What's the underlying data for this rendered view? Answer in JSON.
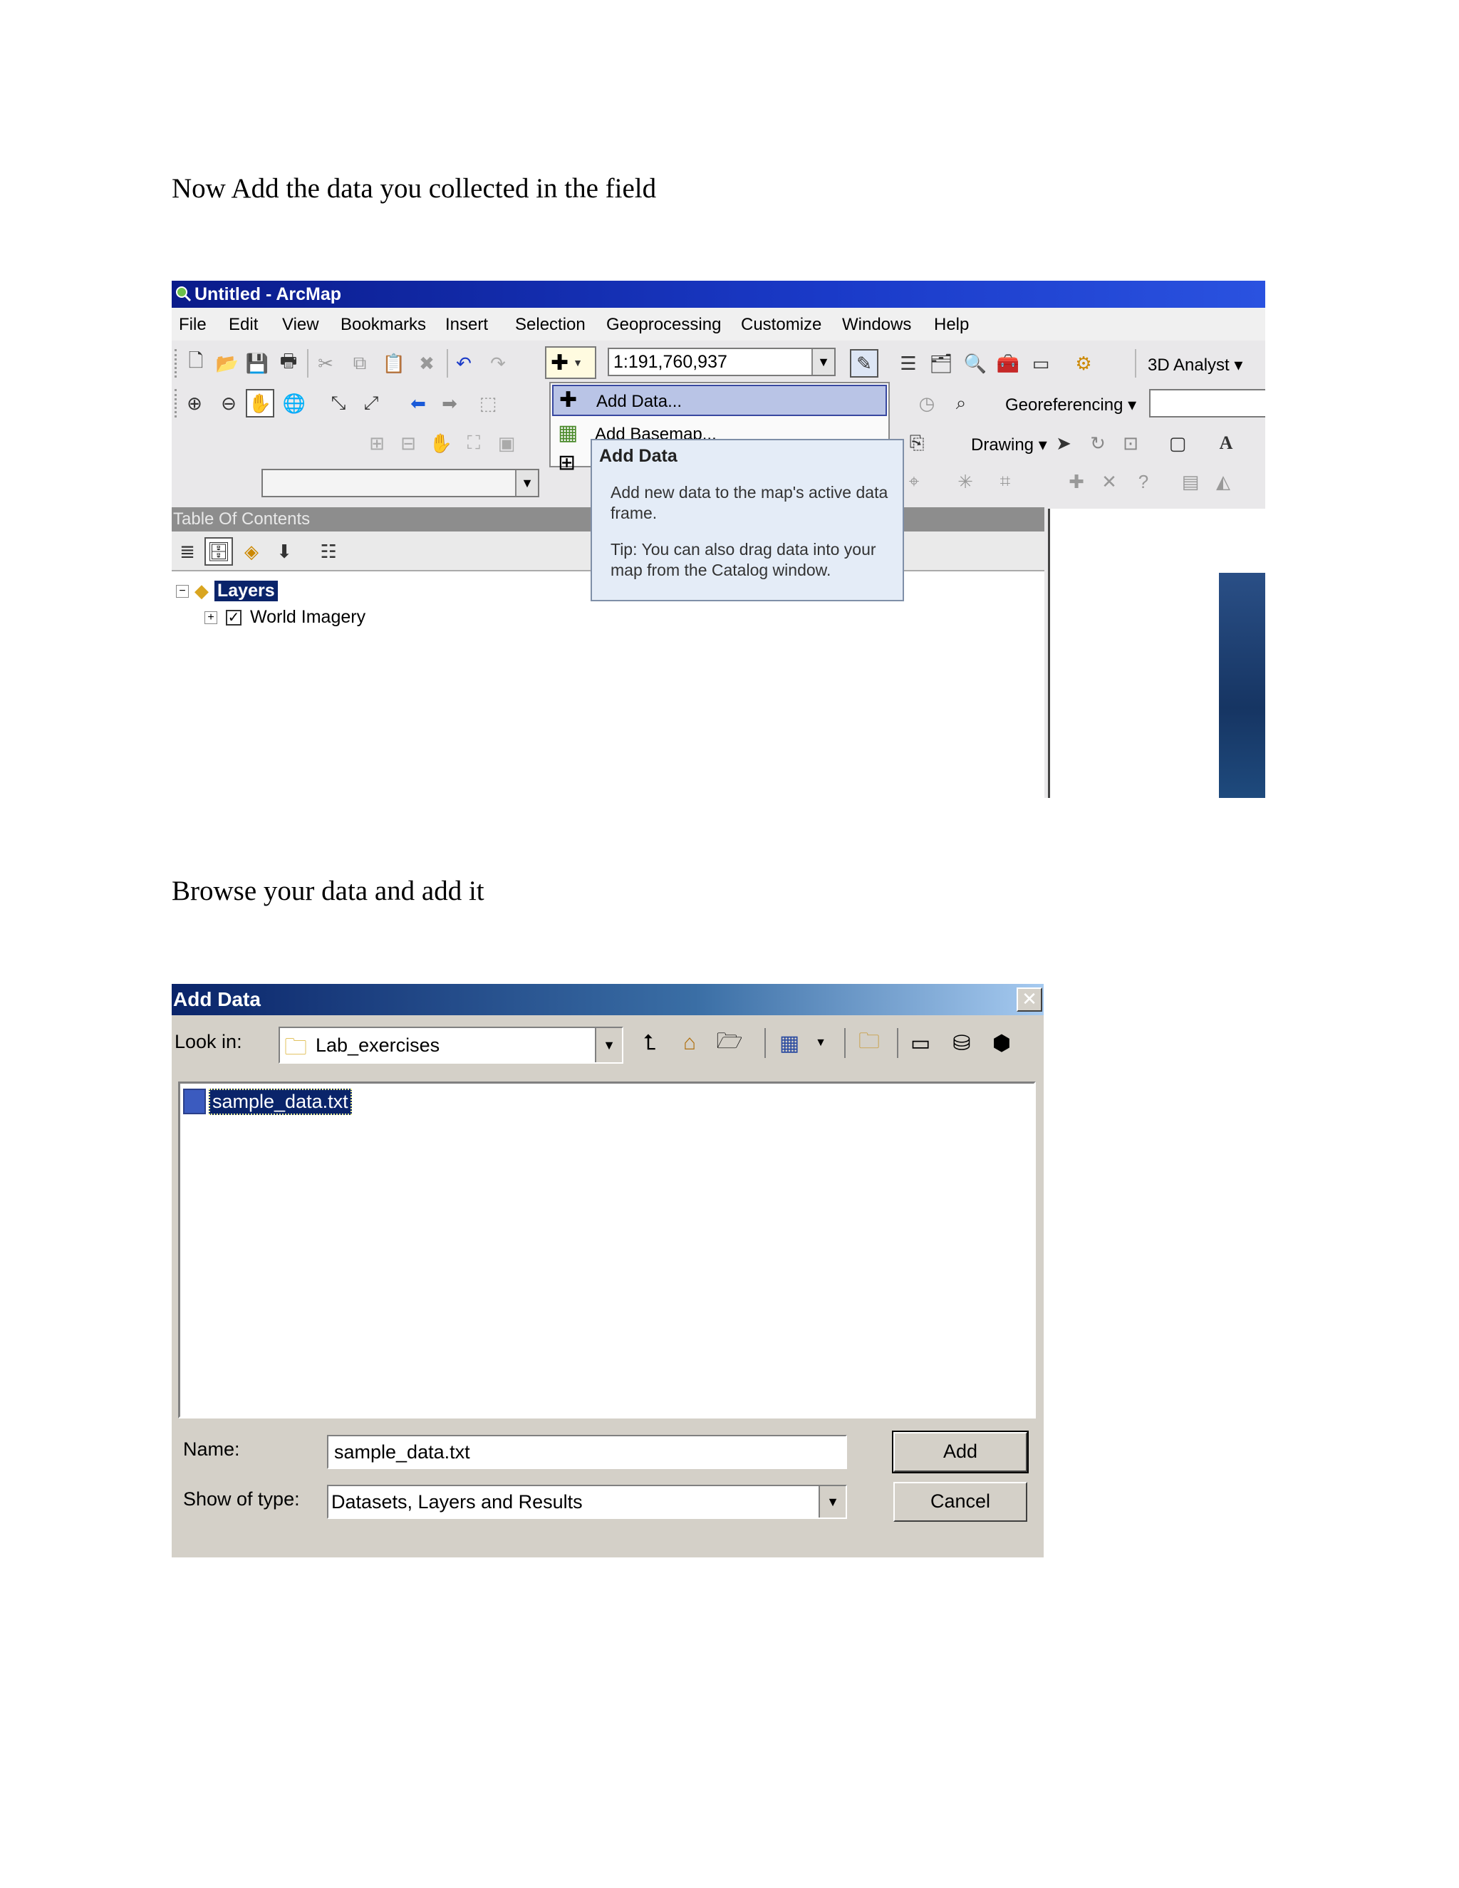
{
  "doc": {
    "heading1": "Now Add the data you collected in the field",
    "heading2": "Browse your data and add it"
  },
  "arcmap": {
    "title": "Untitled - ArcMap",
    "menu": [
      "File",
      "Edit",
      "View",
      "Bookmarks",
      "Insert",
      "Selection",
      "Geoprocessing",
      "Customize",
      "Windows",
      "Help"
    ],
    "scale": "1:191,760,937",
    "toolbars": {
      "analyst": "3D Analyst ▾",
      "georef": "Georeferencing ▾",
      "drawing": "Drawing ▾"
    },
    "dropdown": {
      "add_data": "Add Data...",
      "add_basemap": "Add Basemap..."
    },
    "tooltip": {
      "title": "Add Data",
      "body": "Add new data to the map's active data frame.",
      "tip": "Tip: You can also drag data into your map from the Catalog window."
    },
    "toc": {
      "title": "Table Of Contents",
      "root": "Layers",
      "layer": "World Imagery"
    }
  },
  "add_data_dialog": {
    "title": "Add Data",
    "look_in_label": "Look in:",
    "look_in_value": "Lab_exercises",
    "file": "sample_data.txt",
    "name_label": "Name:",
    "name_value": "sample_data.txt",
    "type_label": "Show of type:",
    "type_value": "Datasets, Layers and Results",
    "add_button": "Add",
    "cancel_button": "Cancel"
  }
}
